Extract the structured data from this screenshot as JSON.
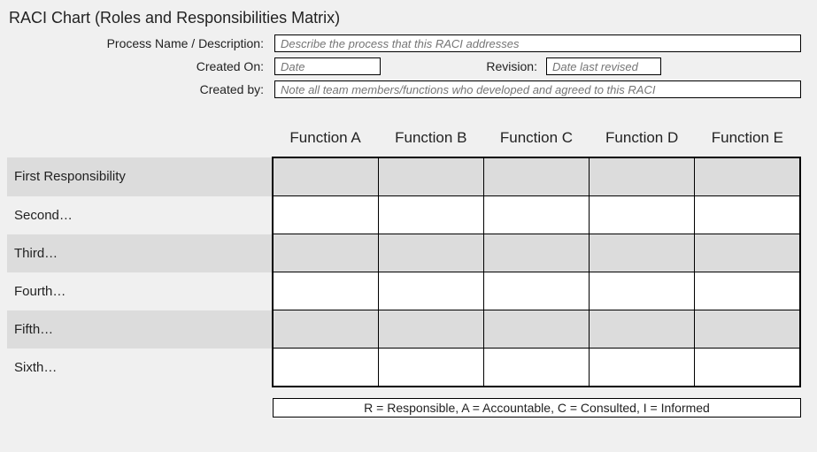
{
  "title": "RACI Chart (Roles and Responsibilities Matrix)",
  "meta": {
    "process_label": "Process Name / Description:",
    "process_placeholder": "Describe the process that this RACI addresses",
    "created_on_label": "Created On:",
    "created_on_placeholder": "Date",
    "revision_label": "Revision:",
    "revision_placeholder": "Date last revised",
    "created_by_label": "Created by:",
    "created_by_placeholder": "Note all team members/functions who developed and agreed to this RACI"
  },
  "chart_data": {
    "type": "table",
    "functions": [
      "Function A",
      "Function B",
      "Function C",
      "Function D",
      "Function E"
    ],
    "responsibilities": [
      "First Responsibility",
      "Second…",
      "Third…",
      "Fourth…",
      "Fifth…",
      "Sixth…"
    ],
    "cells": [
      [
        "",
        "",
        "",
        "",
        ""
      ],
      [
        "",
        "",
        "",
        "",
        ""
      ],
      [
        "",
        "",
        "",
        "",
        ""
      ],
      [
        "",
        "",
        "",
        "",
        ""
      ],
      [
        "",
        "",
        "",
        "",
        ""
      ],
      [
        "",
        "",
        "",
        "",
        ""
      ]
    ]
  },
  "legend": "R = Responsible, A = Accountable, C = Consulted, I = Informed"
}
